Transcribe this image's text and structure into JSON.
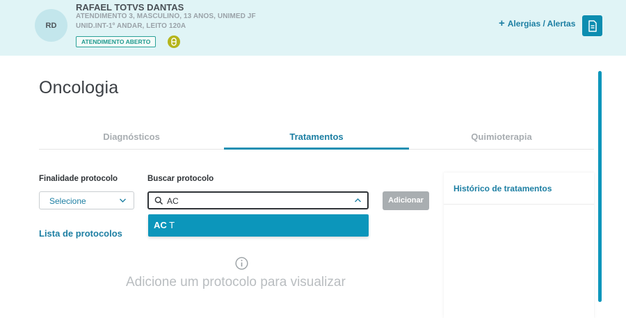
{
  "patient": {
    "initials": "RD",
    "name": "RAFAEL TOTVS DANTAS",
    "line1": "ATENDIMENTO 3, MASCULINO, 13 ANOS, UNIMED JF",
    "line2": "UNID.INT-1º ANDAR, LEITO 120A",
    "status_badge": "ATENDIMENTO ABERTO"
  },
  "header_actions": {
    "allergies_label": "Alergias / Alertas",
    "allergies_prefix": "+"
  },
  "page": {
    "title": "Oncologia"
  },
  "tabs": [
    {
      "label": "Diagnósticos",
      "active": false
    },
    {
      "label": "Tratamentos",
      "active": true
    },
    {
      "label": "Quimioterapia",
      "active": false
    }
  ],
  "form": {
    "purpose_label": "Finalidade protocolo",
    "purpose_value": "Selecione",
    "search_label": "Buscar protocolo",
    "search_value": "AC",
    "add_button": "Adicionar"
  },
  "dropdown": {
    "options": [
      {
        "match": "AC",
        "rest": " T"
      }
    ]
  },
  "protocol_list": {
    "link_label": "Lista de protocolos",
    "empty_message": "Adicione um protocolo para visualizar"
  },
  "history": {
    "title": "Histórico de tratamentos"
  },
  "colors": {
    "accent": "#0c96bb",
    "link": "#1d7fa3",
    "header_bg": "#e0f4f6",
    "badge_green": "#2aa198",
    "pill_icon": "#b5b51b"
  },
  "icons": {
    "pill": "pill-icon",
    "document": "document-icon",
    "search": "search-icon",
    "chevron_down": "chevron-down-icon",
    "chevron_up": "chevron-up-icon",
    "info": "info-icon"
  }
}
